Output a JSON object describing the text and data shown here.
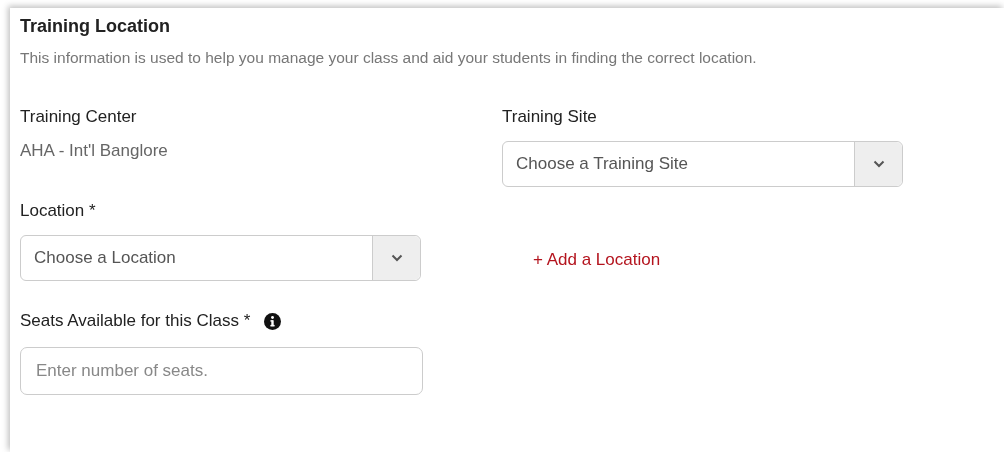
{
  "section": {
    "title": "Training Location",
    "description": "This information is used to help you manage your class and aid your students in finding the correct location."
  },
  "training_center": {
    "label": "Training Center",
    "value": "AHA - Int'l Banglore"
  },
  "training_site": {
    "label": "Training Site",
    "placeholder": "Choose a Training Site"
  },
  "location": {
    "label": "Location *",
    "placeholder": "Choose a Location",
    "add_link": "+ Add a Location"
  },
  "seats": {
    "label": "Seats Available for this Class *",
    "placeholder": "Enter number of seats."
  }
}
